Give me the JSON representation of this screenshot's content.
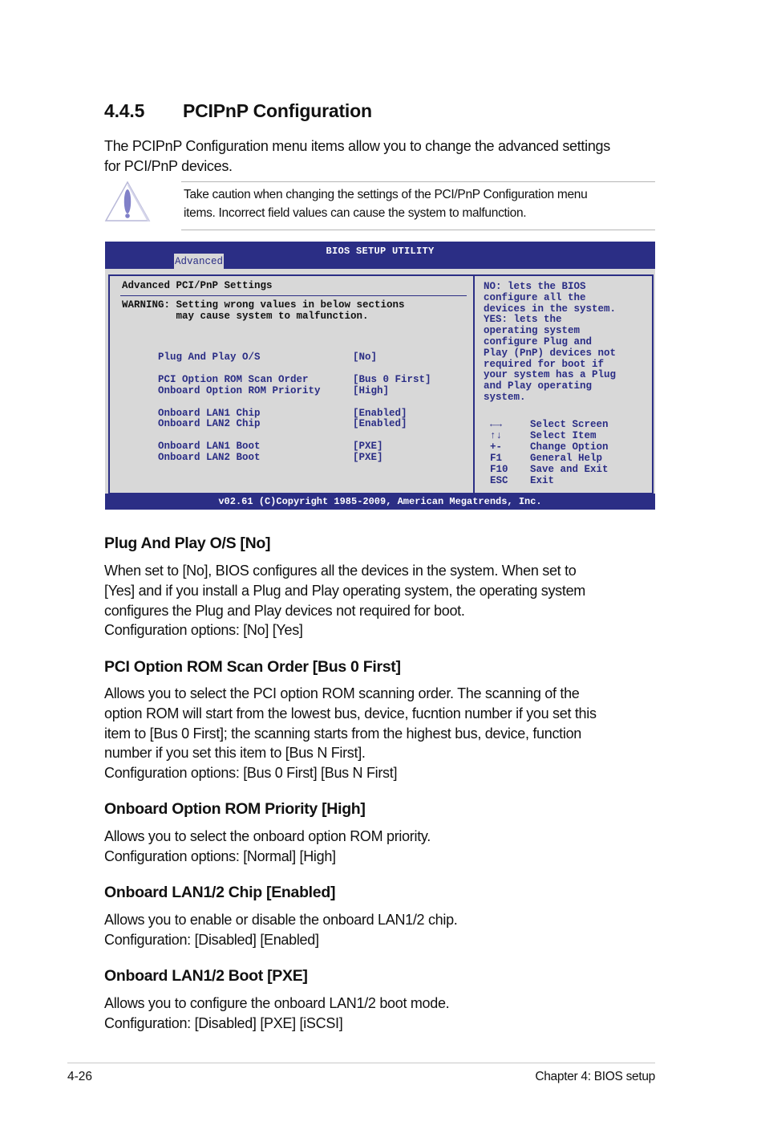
{
  "section": {
    "number": "4.4.5",
    "title": "PCIPnP Configuration",
    "intro_lines": [
      "The PCIPnP Configuration menu items allow you to change the advanced settings",
      "for PCI/PnP devices."
    ]
  },
  "note": {
    "icon": "warning-icon",
    "lines": [
      "Take caution when changing the settings of the PCI/PnP Configuration menu",
      "items. Incorrect field values can cause the system to malfunction."
    ]
  },
  "bios": {
    "title": "BIOS SETUP UTILITY",
    "active_tab": "Advanced",
    "colors": {
      "frame": "#2b2e85",
      "background": "#d8d8d8",
      "text": "#2a2d85"
    },
    "panel_heading": "Advanced PCI/PnP Settings",
    "warning": "WARNING: Setting wrong values in below sections\n         may cause system to malfunction.",
    "settings": [
      {
        "label": "Plug And Play O/S",
        "value": "[No]"
      },
      {
        "label": "PCI Option ROM Scan Order",
        "value": "[Bus 0 First]"
      },
      {
        "label": "Onboard Option ROM Priority",
        "value": "[High]"
      },
      {
        "label": "Onboard LAN1 Chip",
        "value": "[Enabled]"
      },
      {
        "label": "Onboard LAN2 Chip",
        "value": "[Enabled]"
      },
      {
        "label": "Onboard LAN1 Boot",
        "value": "[PXE]"
      },
      {
        "label": "Onboard LAN2 Boot",
        "value": "[PXE]"
      }
    ],
    "help_lines": [
      "NO: lets the BIOS",
      "configure all the",
      "devices in the system.",
      "YES: lets the",
      "operating system",
      "configure Plug and",
      "Play (PnP) devices not",
      "required for boot if",
      "your system has a Plug",
      "and Play operating",
      "system."
    ],
    "keys": [
      {
        "key": "←→",
        "action": "Select Screen"
      },
      {
        "key": "↑↓",
        "action": "Select Item"
      },
      {
        "key": "+-",
        "action": "Change Option"
      },
      {
        "key": "F1",
        "action": "General Help"
      },
      {
        "key": "F10",
        "action": "Save and Exit"
      },
      {
        "key": "ESC",
        "action": "Exit"
      }
    ],
    "footer": "v02.61 (C)Copyright 1985-2009, American Megatrends, Inc."
  },
  "options": [
    {
      "heading": "Plug And Play O/S [No]",
      "lines": [
        "When set to [No], BIOS configures all the devices in the system. When set to",
        "[Yes] and if you install a Plug and Play operating system, the operating system",
        "configures the Plug and Play devices not required for boot.",
        "Configuration options: [No] [Yes]"
      ]
    },
    {
      "heading": "PCI Option ROM Scan Order [Bus 0 First]",
      "lines": [
        "Allows you to select the PCI option ROM scanning order. The scanning of the",
        "option ROM will start from the lowest bus, device, fucntion number if you set this",
        "item to [Bus 0 First]; the scanning starts from the highest bus, device, function",
        "number if you set this item to [Bus N First].",
        "Configuration options: [Bus 0 First] [Bus N First]"
      ]
    },
    {
      "heading": "Onboard Option ROM Priority [High]",
      "lines": [
        "Allows you to select the onboard option ROM priority.",
        "Configuration options: [Normal] [High]"
      ]
    },
    {
      "heading": "Onboard LAN1/2 Chip [Enabled]",
      "lines": [
        "Allows you to enable or disable the onboard LAN1/2 chip.",
        "Configuration: [Disabled] [Enabled]"
      ]
    },
    {
      "heading": "Onboard LAN1/2 Boot [PXE]",
      "lines": [
        "Allows you to configure the onboard LAN1/2 boot mode.",
        "Configuration: [Disabled] [PXE] [iSCSI]"
      ]
    }
  ],
  "footer": {
    "page_number": "4-26",
    "chapter": "Chapter 4: BIOS setup"
  }
}
